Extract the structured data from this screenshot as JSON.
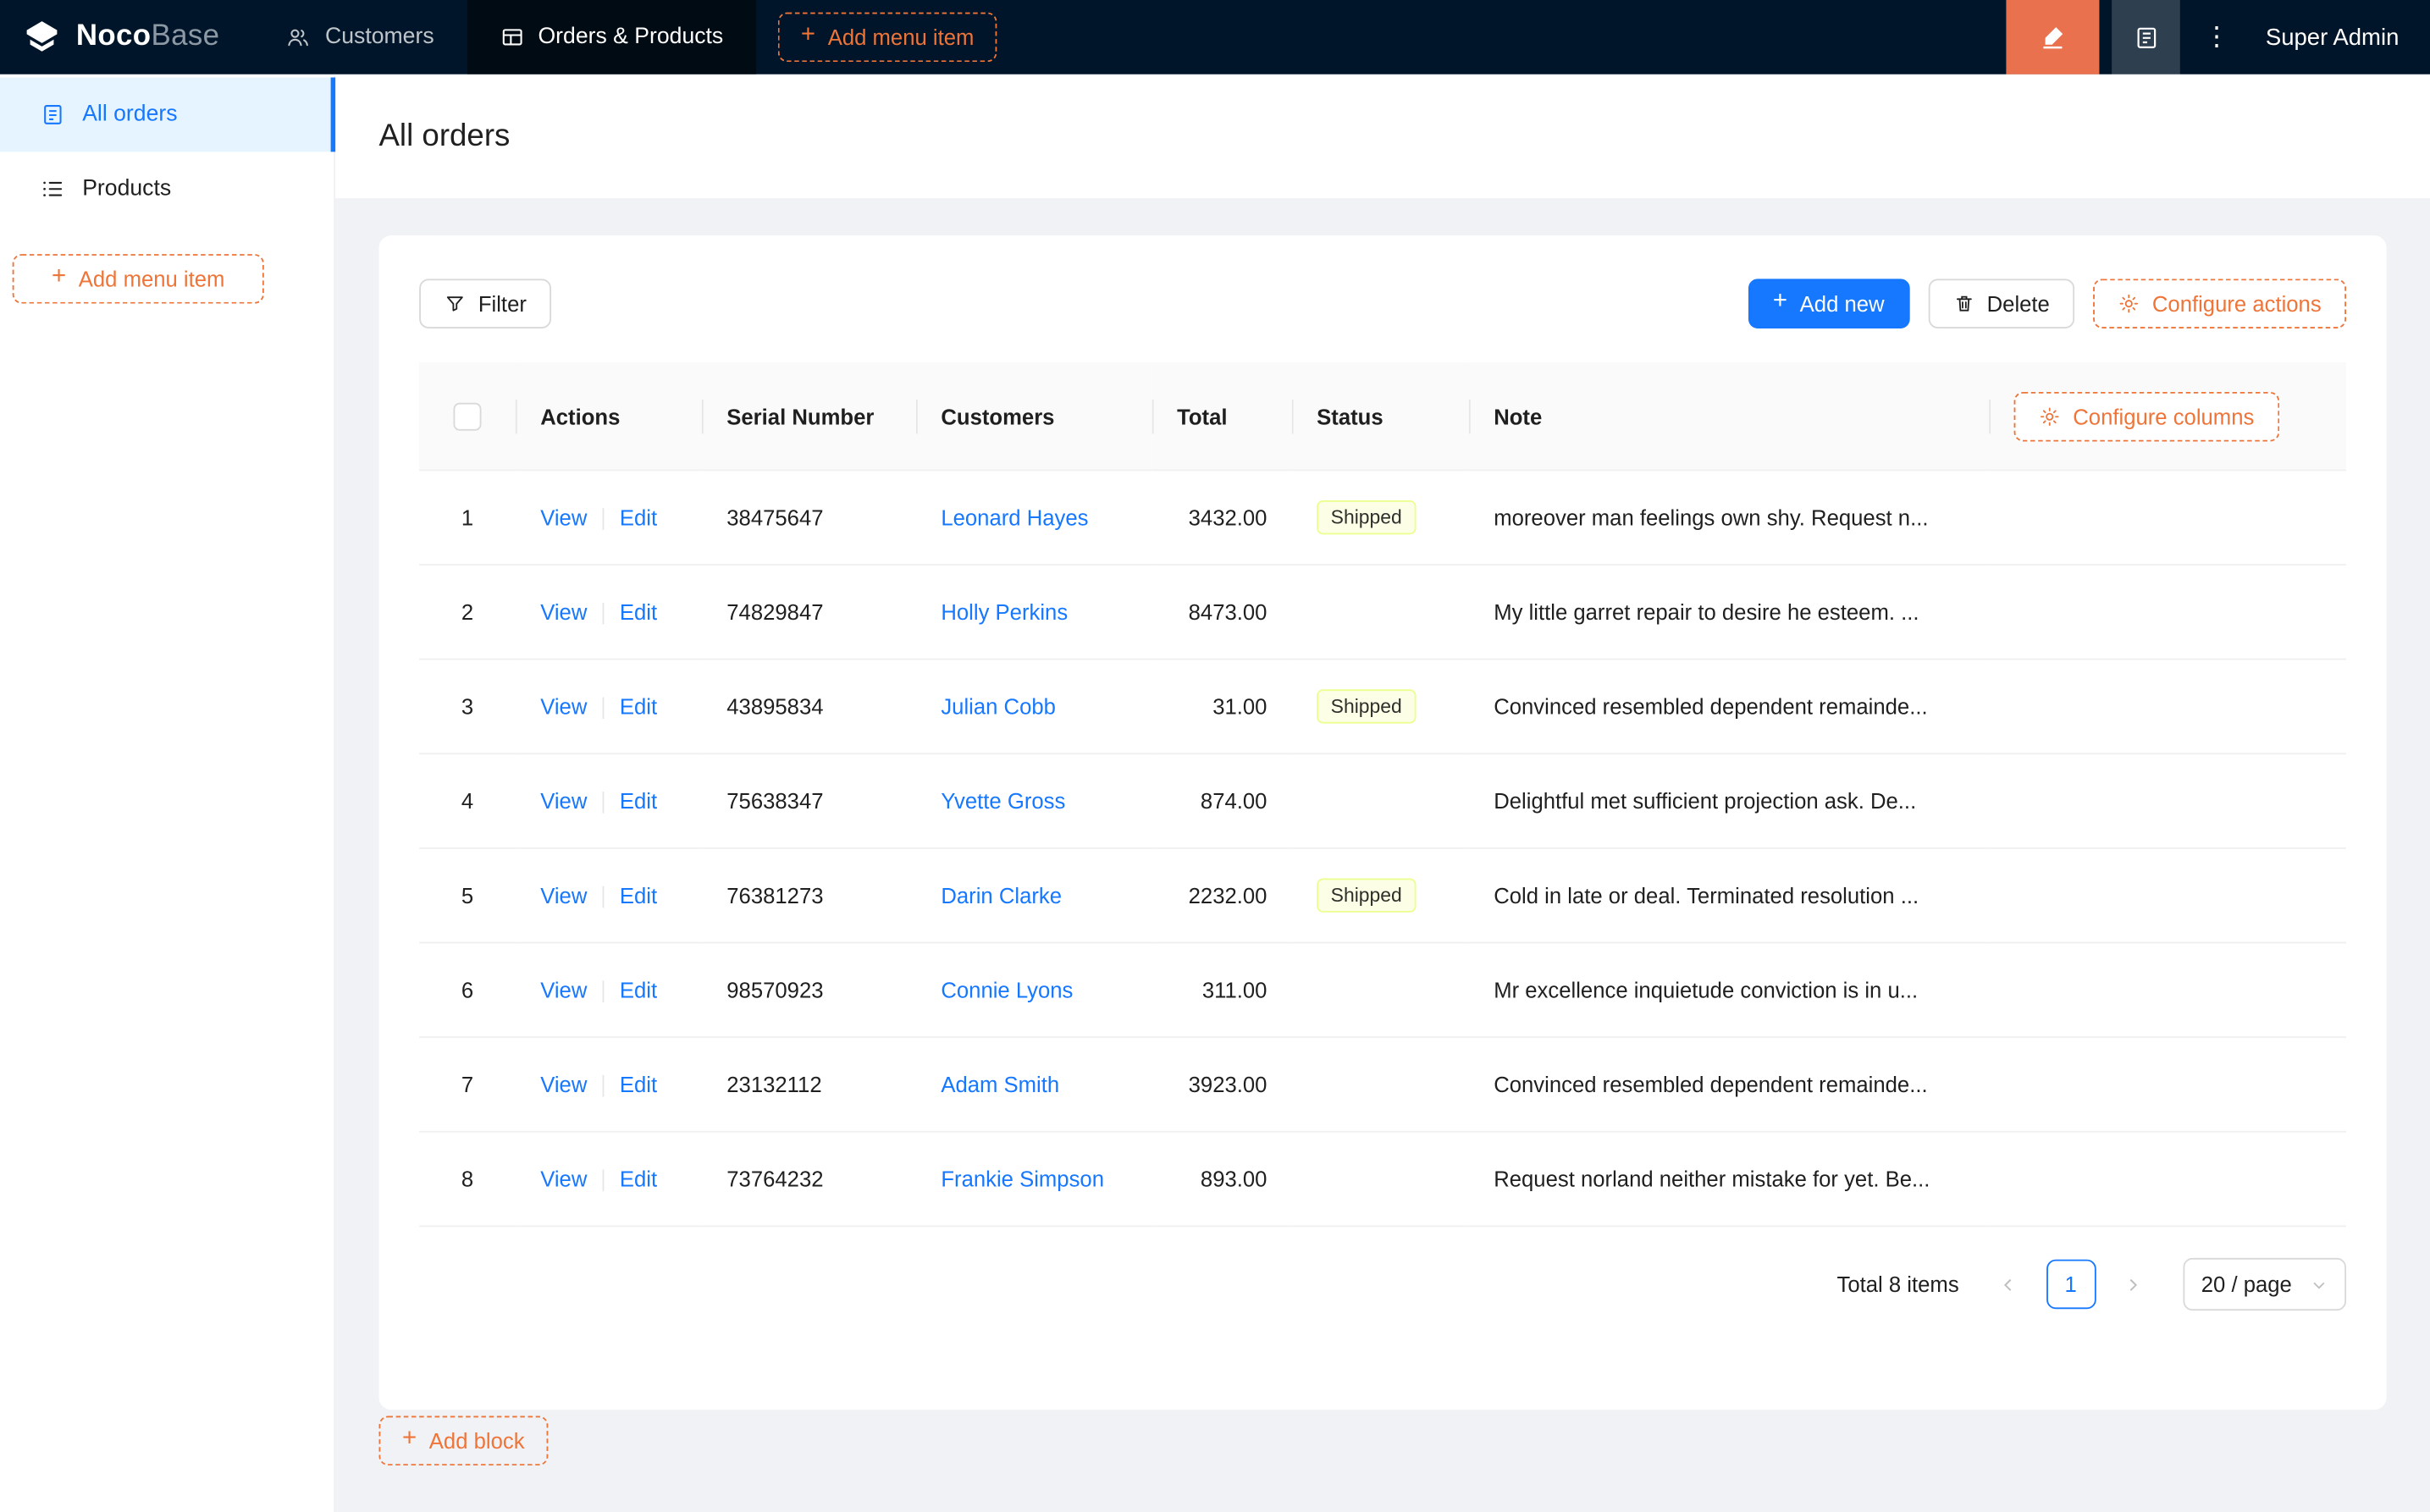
{
  "colors": {
    "topbar_bg": "#001529",
    "primary_blue": "#1677ff",
    "designer_orange": "#ee7438",
    "designer_button_bg": "#e9714d",
    "sidebar_active_bg": "#e6f4ff",
    "status_shipped_bg": "#fcffe6",
    "status_shipped_border": "#eaff8f"
  },
  "icons": {
    "plus": "+",
    "more": "⋮"
  },
  "topbar": {
    "logo_bold": "Noco",
    "logo_light": "Base",
    "nav": [
      {
        "label": "Customers"
      },
      {
        "label": "Orders & Products"
      }
    ],
    "add_menu_item": "Add menu item",
    "user": "Super Admin"
  },
  "sidebar": {
    "items": [
      {
        "label": "All orders"
      },
      {
        "label": "Products"
      }
    ],
    "add_menu_item": "Add menu item"
  },
  "page": {
    "title": "All orders"
  },
  "toolbar": {
    "filter": "Filter",
    "add_new": "Add new",
    "delete": "Delete",
    "configure_actions": "Configure actions"
  },
  "table": {
    "headers": {
      "actions": "Actions",
      "serial": "Serial Number",
      "customers": "Customers",
      "total": "Total",
      "status": "Status",
      "note": "Note"
    },
    "configure_columns": "Configure columns",
    "actions": {
      "view": "View",
      "edit": "Edit"
    },
    "rows": [
      {
        "index": "1",
        "serial": "38475647",
        "customer": "Leonard Hayes",
        "total": "3432.00",
        "status": "Shipped",
        "note": "moreover man feelings own shy. Request n..."
      },
      {
        "index": "2",
        "serial": "74829847",
        "customer": "Holly Perkins",
        "total": "8473.00",
        "status": "",
        "note": "My little garret repair to desire he esteem. ..."
      },
      {
        "index": "3",
        "serial": "43895834",
        "customer": "Julian Cobb",
        "total": "31.00",
        "status": "Shipped",
        "note": "Convinced resembled dependent remainde..."
      },
      {
        "index": "4",
        "serial": "75638347",
        "customer": "Yvette Gross",
        "total": "874.00",
        "status": "",
        "note": "Delightful met sufficient projection ask. De..."
      },
      {
        "index": "5",
        "serial": "76381273",
        "customer": "Darin Clarke",
        "total": "2232.00",
        "status": "Shipped",
        "note": "Cold in late or deal. Terminated resolution ..."
      },
      {
        "index": "6",
        "serial": "98570923",
        "customer": "Connie Lyons",
        "total": "311.00",
        "status": "",
        "note": "Mr excellence inquietude conviction is in u..."
      },
      {
        "index": "7",
        "serial": "23132112",
        "customer": "Adam Smith",
        "total": "3923.00",
        "status": "",
        "note": "Convinced resembled dependent remainde..."
      },
      {
        "index": "8",
        "serial": "73764232",
        "customer": "Frankie Simpson",
        "total": "893.00",
        "status": "",
        "note": "Request norland neither mistake for yet. Be..."
      }
    ]
  },
  "pagination": {
    "total": "Total 8 items",
    "current_page": "1",
    "page_size": "20 / page"
  },
  "add_block": "Add block"
}
